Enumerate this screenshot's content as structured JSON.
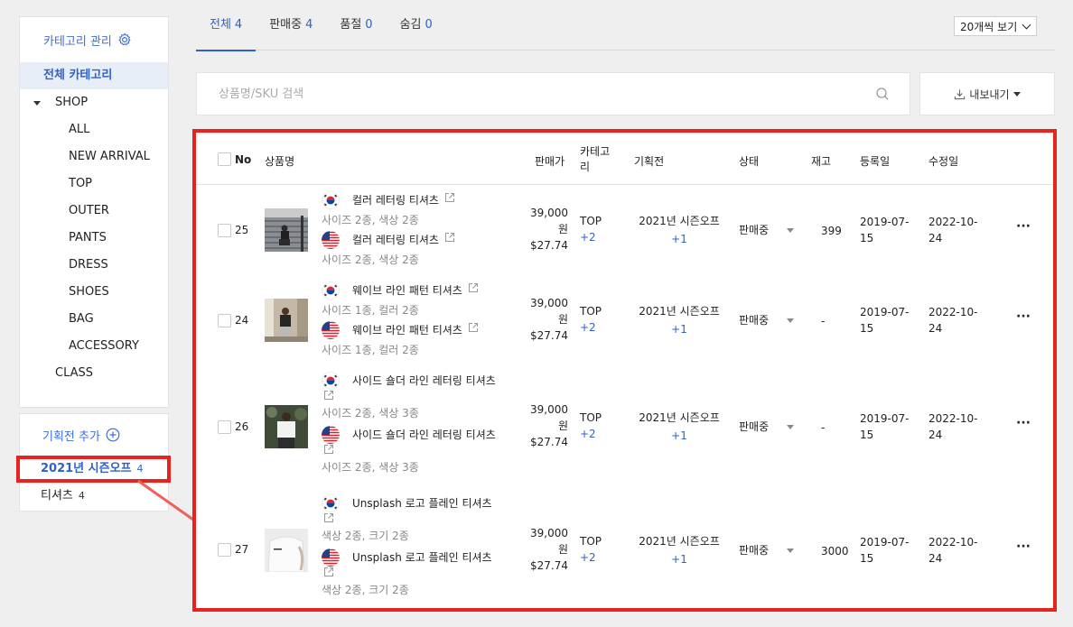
{
  "sidebar": {
    "category_manage": "카테고리 관리",
    "all_categories": "전체 카테고리",
    "shop": "SHOP",
    "shop_items": [
      "ALL",
      "NEW ARRIVAL",
      "TOP",
      "OUTER",
      "PANTS",
      "DRESS",
      "SHOES",
      "BAG",
      "ACCESSORY"
    ],
    "class": "CLASS",
    "add_exhibition": "기획전 추가",
    "exhibitions": [
      {
        "label": "2021년 시즌오프",
        "count": "4"
      },
      {
        "label": "티셔츠",
        "count": "4"
      }
    ]
  },
  "tabs": [
    {
      "label": "전체",
      "count": "4"
    },
    {
      "label": "판매중",
      "count": "4"
    },
    {
      "label": "품절",
      "count": "0"
    },
    {
      "label": "숨김",
      "count": "0"
    }
  ],
  "per_page": "20개씩 보기",
  "search": {
    "placeholder": "상품명/SKU 검색"
  },
  "export_label": "내보내기",
  "table": {
    "headers": {
      "no": "No",
      "name": "상품명",
      "price": "판매가",
      "category": "카테고리",
      "exhibition": "기획전",
      "status": "상태",
      "stock": "재고",
      "registered": "등록일",
      "modified": "수정일"
    },
    "rows": [
      {
        "no": "25",
        "kr_name": "컬러 레터링 티셔츠",
        "kr_sub": "사이즈 2종, 색상 2종",
        "us_name": "컬러 레터링 티셔츠",
        "us_sub": "사이즈 2종, 색상 2종",
        "price_krw_num": "39,000",
        "price_krw_unit": "원",
        "price_usd": "$27.74",
        "category": "TOP",
        "category_more": "+2",
        "exhibition": "2021년 시즌오프",
        "exhibition_more": "+1",
        "status": "판매중",
        "stock": "399",
        "registered_a": "2019-07-",
        "registered_b": "15",
        "modified_a": "2022-10-",
        "modified_b": "24",
        "more": "···"
      },
      {
        "no": "24",
        "kr_name": "웨이브 라인 패턴 티셔츠",
        "kr_sub": "사이즈 1종, 컬러 2종",
        "us_name": "웨이브 라인 패턴 티셔츠",
        "us_sub": "사이즈 1종, 컬러 2종",
        "price_krw_num": "39,000",
        "price_krw_unit": "원",
        "price_usd": "$27.74",
        "category": "TOP",
        "category_more": "+2",
        "exhibition": "2021년 시즌오프",
        "exhibition_more": "+1",
        "status": "판매중",
        "stock": "-",
        "registered_a": "2019-07-",
        "registered_b": "15",
        "modified_a": "2022-10-",
        "modified_b": "24",
        "more": "···"
      },
      {
        "no": "26",
        "kr_name": "사이드 숄더 라인 레터링 티셔츠",
        "kr_sub": "사이즈 2종, 색상 3종",
        "us_name": "사이드 숄더 라인 레터링 티셔츠",
        "us_sub": "사이즈 2종, 색상 3종",
        "price_krw_num": "39,000",
        "price_krw_unit": "원",
        "price_usd": "$27.74",
        "category": "TOP",
        "category_more": "+2",
        "exhibition": "2021년 시즌오프",
        "exhibition_more": "+1",
        "status": "판매중",
        "stock": "-",
        "registered_a": "2019-07-",
        "registered_b": "15",
        "modified_a": "2022-10-",
        "modified_b": "24",
        "more": "···"
      },
      {
        "no": "27",
        "kr_name": "Unsplash 로고 플레인 티셔츠",
        "kr_sub": "색상 2종, 크기 2종",
        "us_name": "Unsplash 로고 플레인 티셔츠",
        "us_sub": "색상 2종, 크기 2종",
        "price_krw_num": "39,000",
        "price_krw_unit": "원",
        "price_usd": "$27.74",
        "category": "TOP",
        "category_more": "+2",
        "exhibition": "2021년 시즌오프",
        "exhibition_more": "+1",
        "status": "판매중",
        "stock": "3000",
        "registered_a": "2019-07-",
        "registered_b": "15",
        "modified_a": "2022-10-",
        "modified_b": "24",
        "more": "···"
      }
    ]
  },
  "colors": {
    "accent": "#2e62c9",
    "highlight": "#e8231e"
  }
}
